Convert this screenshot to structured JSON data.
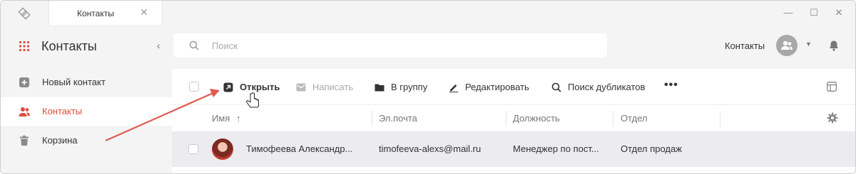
{
  "titlebar": {
    "tab_label": "Контакты",
    "tab_close": "✕",
    "minimize": "—",
    "maximize": "☐",
    "close": "✕"
  },
  "sidebar": {
    "title": "Контакты",
    "collapse_icon": "‹",
    "items": [
      {
        "label": "Новый контакт",
        "icon": "plus-square-icon",
        "active": false
      },
      {
        "label": "Контакты",
        "icon": "users-icon",
        "active": true
      },
      {
        "label": "Корзина",
        "icon": "trash-icon",
        "active": false
      }
    ]
  },
  "header": {
    "search_placeholder": "Поиск",
    "section_label": "Контакты",
    "caret": "▼"
  },
  "toolbar": {
    "open_label": "Открыть",
    "write_label": "Написать",
    "group_label": "В группу",
    "edit_label": "Редактировать",
    "duplicates_label": "Поиск дубликатов",
    "more": "•••"
  },
  "table": {
    "columns": [
      "Имя",
      "Эл.почта",
      "Должность",
      "Отдел"
    ],
    "sort_indicator": "↑",
    "rows": [
      {
        "name": "Тимофеева Александр...",
        "email": "timofeeva-alexs@mail.ru",
        "position": "Менеджер по пост...",
        "department": "Отдел продаж"
      }
    ]
  },
  "colors": {
    "accent": "#e04a3c",
    "sidebar_bg": "#f4f4f4",
    "row_selected": "#ebebf0",
    "annotation_arrow": "#e05a50"
  }
}
